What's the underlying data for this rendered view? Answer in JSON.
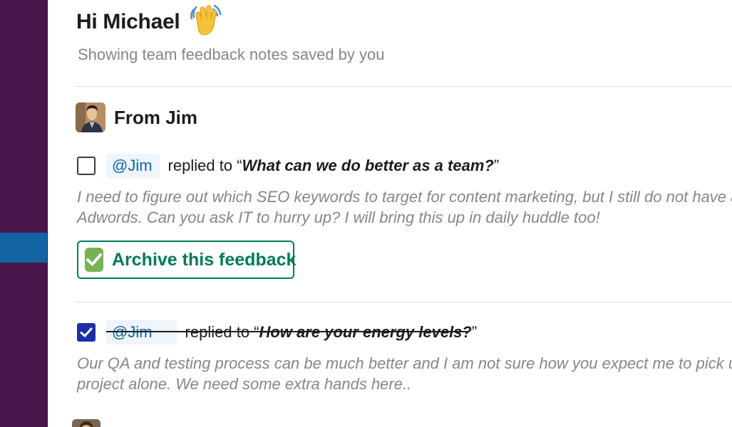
{
  "header": {
    "greeting": "Hi Michael",
    "wave_emoji": "waving-hand",
    "subtitle": "Showing team feedback notes saved by you"
  },
  "section": {
    "title": "From Jim"
  },
  "feedback": [
    {
      "checked": false,
      "mention": "@Jim",
      "replied_to": "replied to",
      "open_quote": "“",
      "question": "What can we do better as a team?",
      "close_quote": "”",
      "note_line1": "I need to figure out which SEO keywords to target for content marketing, but I still do not have access to",
      "note_line2": "Adwords. Can you ask IT to hurry up? I will bring this up in daily huddle too!",
      "action_label": "Archive this feedback"
    },
    {
      "checked": true,
      "mention": "@Jim",
      "replied_to": "replied to",
      "open_quote": "“",
      "question": "How are your energy levels?",
      "close_quote": "”",
      "note_line1": "Our QA and testing process can be much better and I am not sure how you expect me to pick up this",
      "note_line2": "project alone. We need some extra hands here.."
    }
  ],
  "colors": {
    "sidebar": "#4a154b",
    "sidebar_active": "#1264a3",
    "mention": "#1264a3",
    "archive_green": "#007a5a",
    "checkbox_checked": "#1d2ea8"
  }
}
